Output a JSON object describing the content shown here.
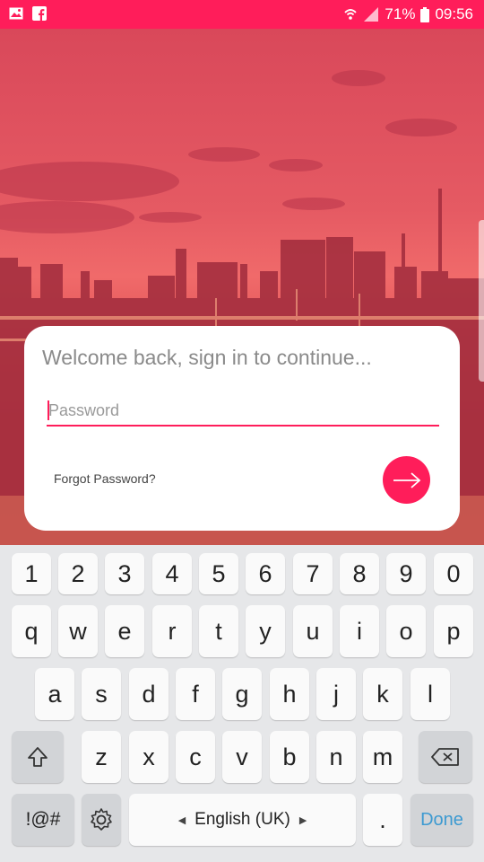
{
  "status_bar": {
    "left_icons": [
      "image-icon",
      "facebook-icon"
    ],
    "battery_percent": "71%",
    "time": "09:56"
  },
  "login": {
    "welcome_text": "Welcome back, sign in to continue...",
    "password_placeholder": "Password",
    "password_value": "",
    "forgot_link": "Forgot Password?",
    "submit_icon": "arrow-right-icon",
    "accent_color": "#ff1d5a"
  },
  "keyboard": {
    "row_numbers": [
      "1",
      "2",
      "3",
      "4",
      "5",
      "6",
      "7",
      "8",
      "9",
      "0"
    ],
    "row_1": [
      "q",
      "w",
      "e",
      "r",
      "t",
      "y",
      "u",
      "i",
      "o",
      "p"
    ],
    "row_2": [
      "a",
      "s",
      "d",
      "f",
      "g",
      "h",
      "j",
      "k",
      "l"
    ],
    "row_3": [
      "z",
      "x",
      "c",
      "v",
      "b",
      "n",
      "m"
    ],
    "symbols_label": "!@#",
    "space_label": "English (UK)",
    "period_label": ".",
    "done_label": "Done",
    "done_color": "#3d9ad1"
  }
}
